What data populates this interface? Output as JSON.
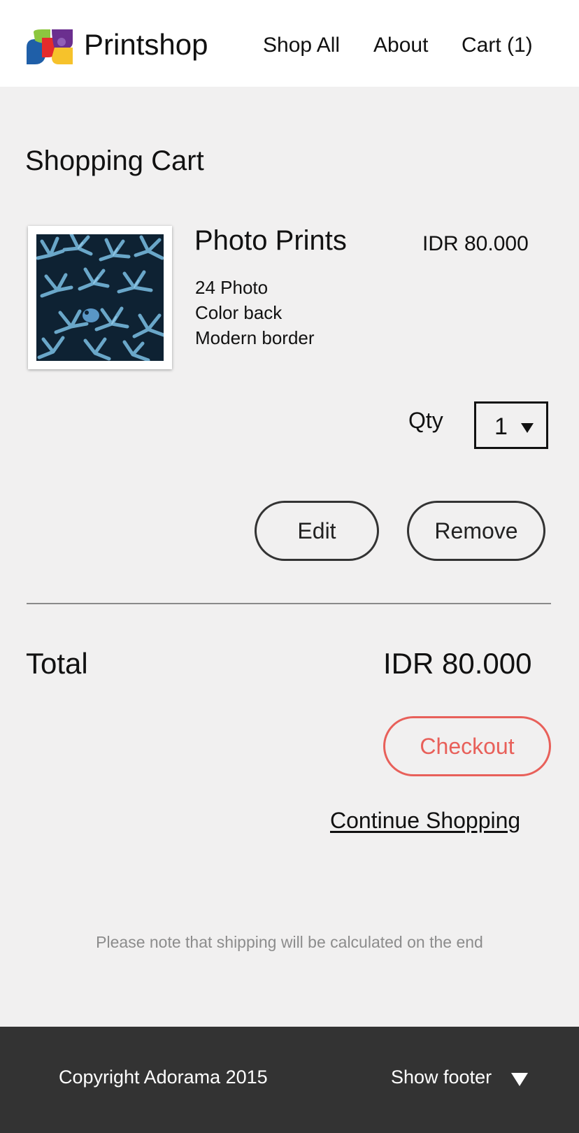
{
  "header": {
    "brand": "Printshop",
    "nav": {
      "shop_all": "Shop All",
      "about": "About",
      "cart": "Cart (1)"
    }
  },
  "cart": {
    "title": "Shopping Cart",
    "item": {
      "image_icon": "coral-photo-thumbnail",
      "name": "Photo Prints",
      "price": "IDR 80.000",
      "details": [
        "24 Photo",
        "Color back",
        "Modern border"
      ],
      "qty_label": "Qty",
      "qty_value": "1",
      "edit_label": "Edit",
      "remove_label": "Remove"
    },
    "total_label": "Total",
    "total_value": "IDR 80.000",
    "checkout_label": "Checkout",
    "continue_label": "Continue Shopping",
    "shipping_note": "Please note that shipping will be calculated on the end"
  },
  "footer": {
    "copyright": "Copyright Adorama 2015",
    "show_footer": "Show footer"
  },
  "colors": {
    "background": "#f1f0f0",
    "header": "#ffffff",
    "footer": "#333333",
    "accent": "#e8605a"
  }
}
